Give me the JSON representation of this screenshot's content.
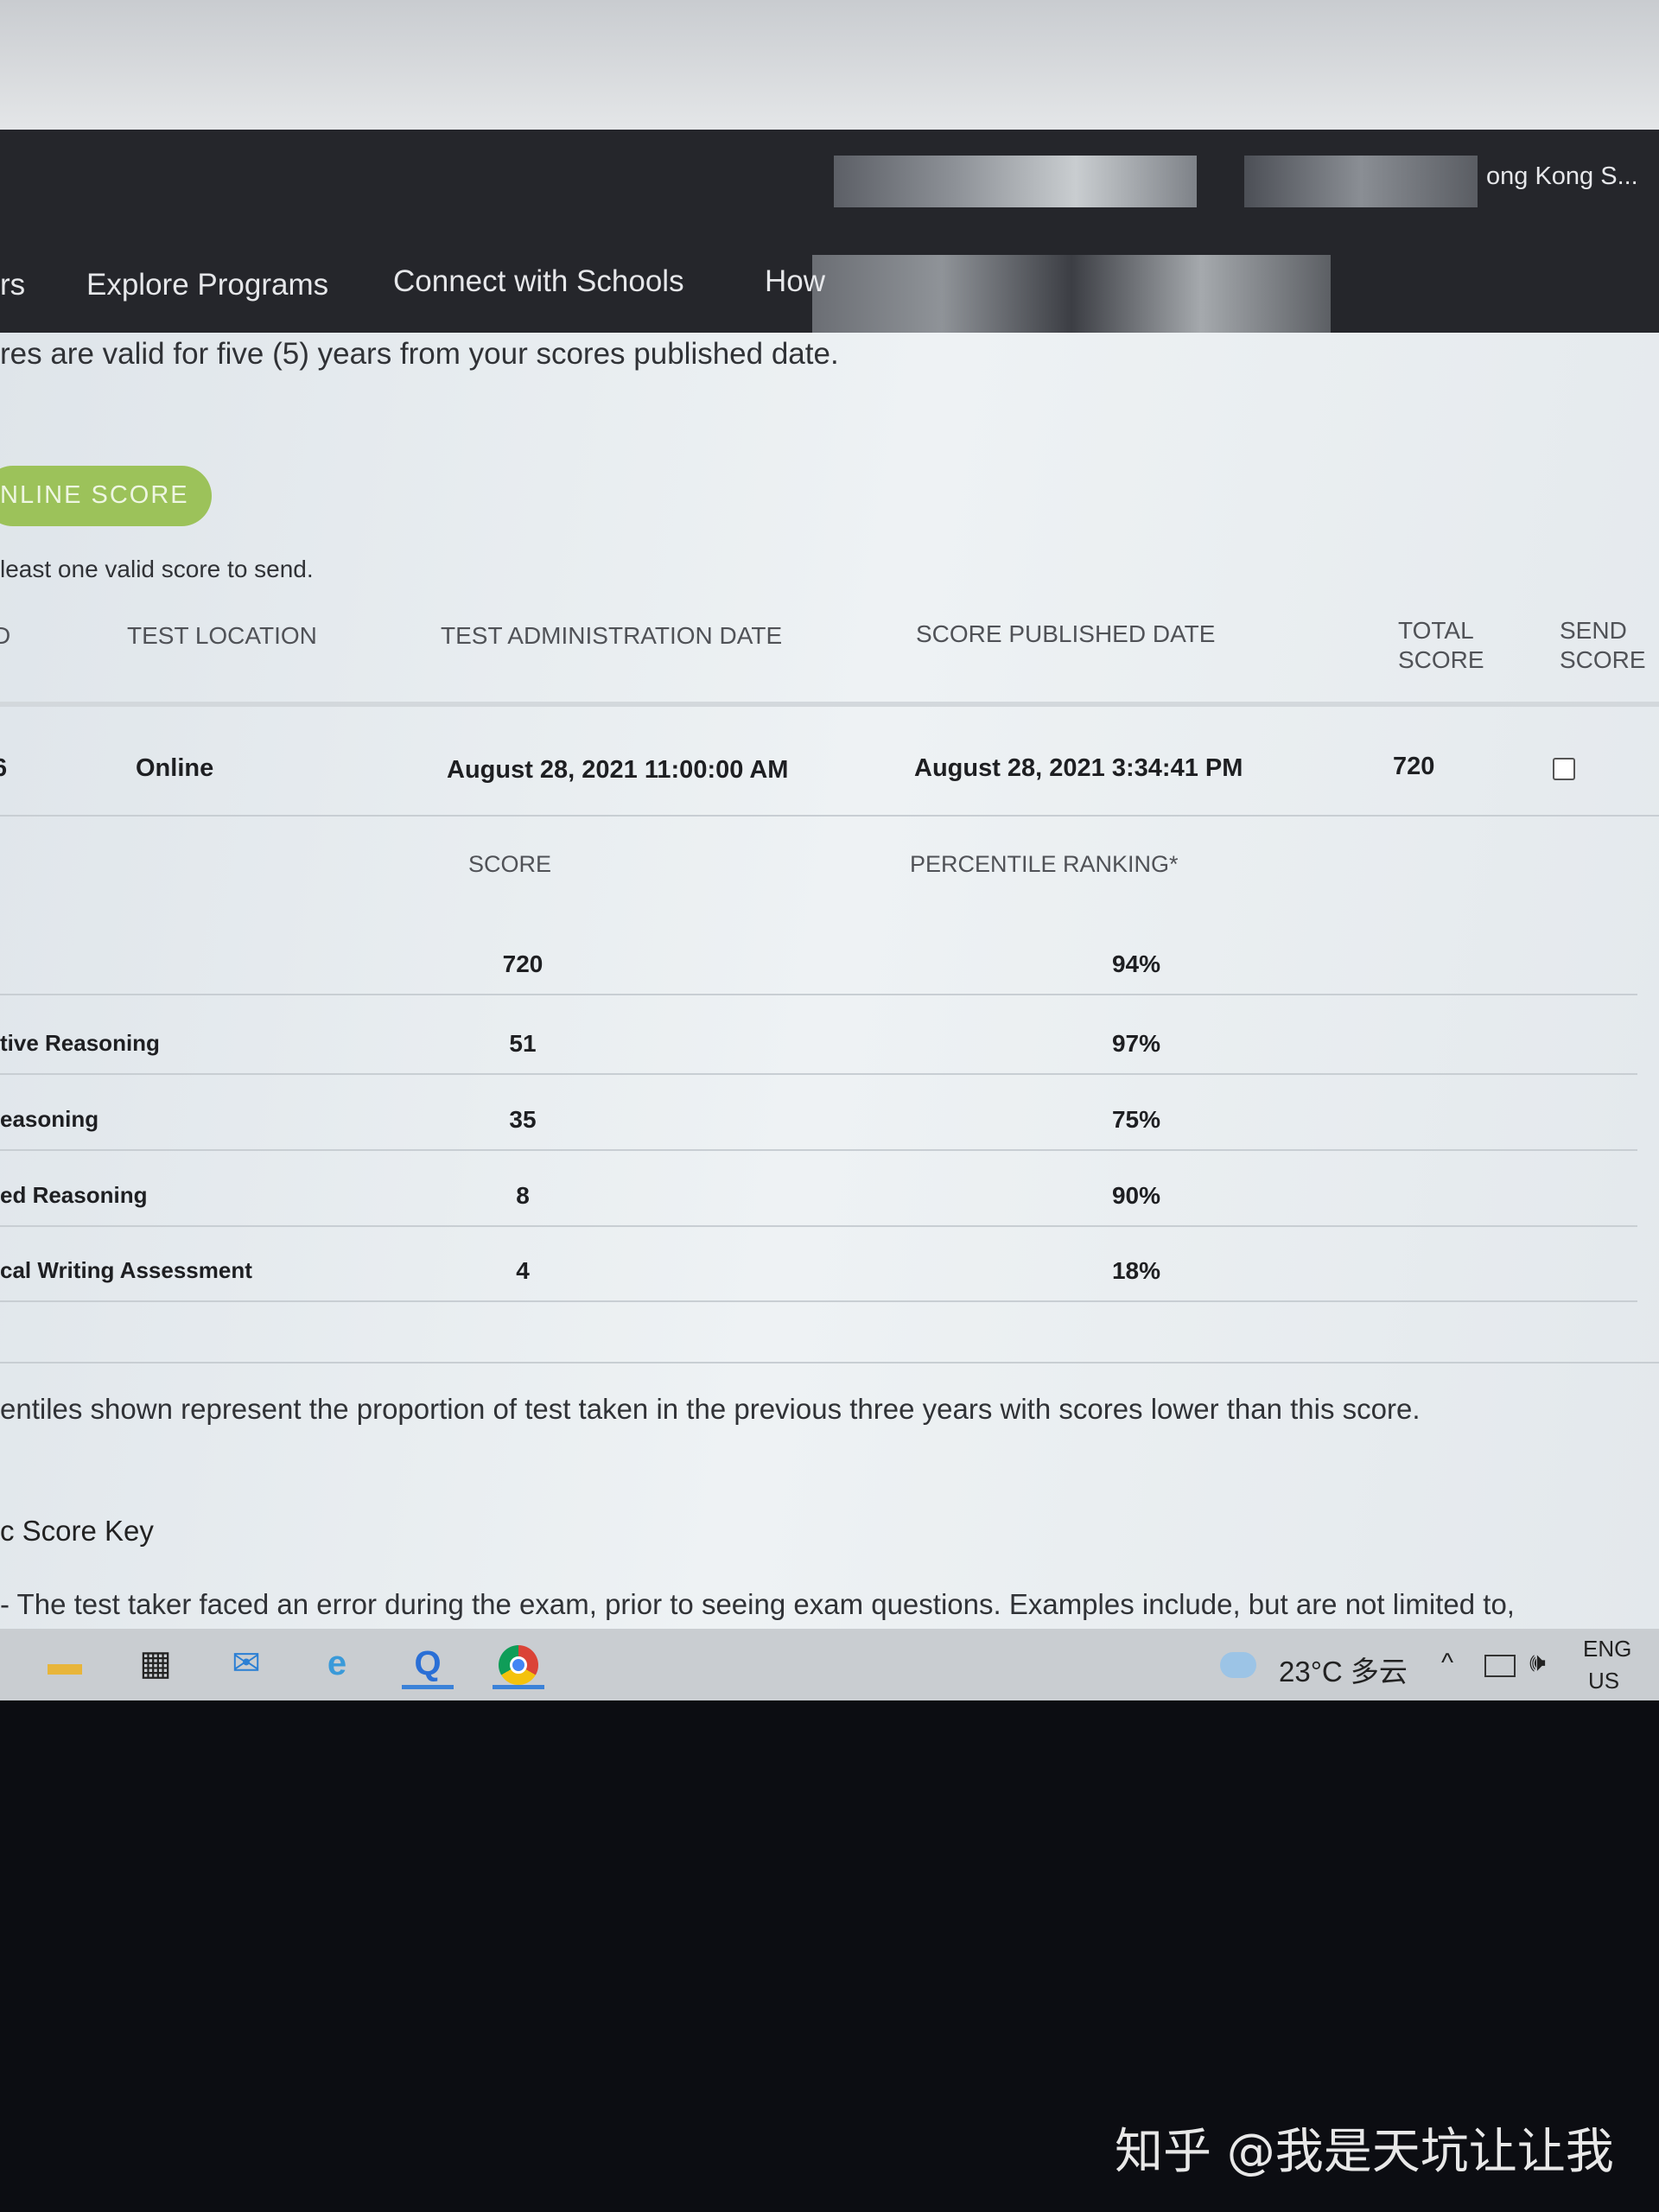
{
  "header": {
    "account_name": "ong Kong S..."
  },
  "nav": {
    "items": [
      "rs",
      "Explore Programs",
      "Connect with Schools",
      "How"
    ]
  },
  "notice": "res are valid for five (5) years from your scores published date.",
  "send_button": "NLINE SCORE",
  "send_hint": "least one valid score to send.",
  "table": {
    "headers": [
      "D",
      "TEST LOCATION",
      "TEST ADMINISTRATION DATE",
      "SCORE PUBLISHED DATE",
      "TOTAL SCORE",
      "SEND SCORE"
    ],
    "row": {
      "id": "6",
      "location": "Online",
      "admin_date": "August 28, 2021 11:00:00 AM",
      "published_date": "August 28, 2021 3:34:41 PM",
      "total": "720",
      "send_checked": false
    }
  },
  "breakdown": {
    "headers": [
      "SCORE",
      "PERCENTILE RANKING*"
    ],
    "rows": [
      {
        "name": "",
        "score": "720",
        "pct": "94%"
      },
      {
        "name": "tive Reasoning",
        "score": "51",
        "pct": "97%"
      },
      {
        "name": "easoning",
        "score": "35",
        "pct": "75%"
      },
      {
        "name": "ed Reasoning",
        "score": "8",
        "pct": "90%"
      },
      {
        "name": "cal Writing Assessment",
        "score": "4",
        "pct": "18%"
      }
    ]
  },
  "footnote": "entiles shown represent the proportion of test taken in the previous three years with scores lower than this score.",
  "score_key_title": "c Score Key",
  "score_key_text": "- The test taker faced an error during the exam, prior to seeing exam questions. Examples include, but are not limited to,",
  "taskbar": {
    "icons": [
      "file-explorer-icon",
      "store-icon",
      "mail-icon",
      "ie-icon",
      "q-app-icon",
      "chrome-icon"
    ],
    "weather": "23°C 多云",
    "lang1": "ENG",
    "lang2": "US"
  },
  "watermark": "知乎 @我是天坑让让我"
}
